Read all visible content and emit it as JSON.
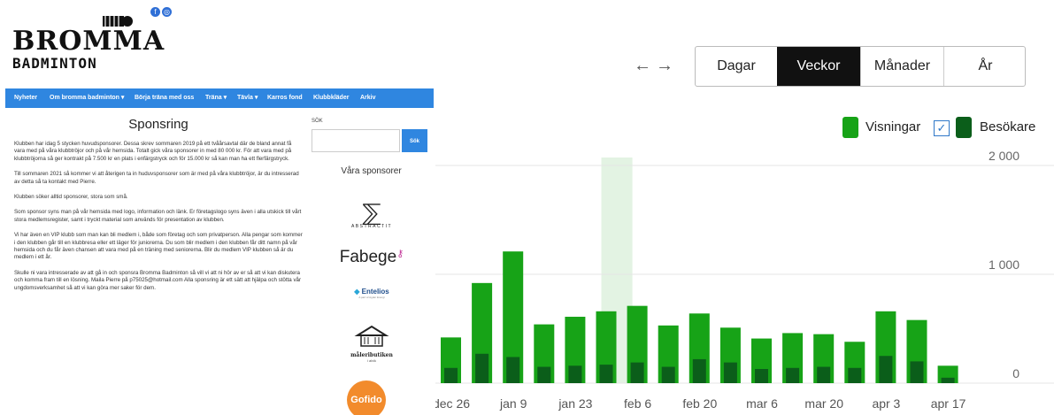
{
  "site": {
    "logo_line1": "BROMMA",
    "logo_line2": "BADMINTON",
    "nav": [
      "Nyheter",
      "Om bromma badminton ▾",
      "Börja träna med oss",
      "Träna ▾",
      "Tävla ▾",
      "Karros fond",
      "Klubbkläder",
      "Arkiv"
    ],
    "title": "Sponsring",
    "paragraphs": [
      "Klubben har idag 5 stycken huvudsponsorer. Dessa skrev sommaren 2019 på ett tvåårsavtal där de bland annat få vara med på våra klubbtröjor och på vår hemsida. Totalt gick våra sponsorer in med 80 000 kr. För att vara med på klubbtröjorna så ger kontrakt på 7.500 kr en plats i enfärgstryck och för 15.000 kr så kan man ha ett flerfärgstryck.",
      "Till sommaren 2021 så kommer vi att återigen ta in huduvsponsorer som är med på våra klubbtröjor, är du intresserad av detta så ta kontakt med Pierre.",
      "Klubben söker alltid sponsorer, stora som små.",
      "Som sponsor syns man på vår hemsida med logo, information och länk. Er företagslogo syns även i alla utskick till vårt stora medlemsregister, samt i tryckt material som används för presentation av klubben.",
      "Vi har även en VIP klubb som man kan bli medlem i, både som företag och som privatperson. Alla pengar som kommer i den klubben går till en klubbresa eller ett läger för juniorerna. Du som blir medlem i den klubben får ditt namn på vår hemsida och du får även chansen att vara med på en träning med seniorerna. Blir du medlem VIP klubben så är du medlem i ett år.",
      "Skulle ni vara intresserade av att gå in och sponsra Bromma Badminton så vill vi att ni hör av er så att vi kan diskutera och komma fram till en lösning. Maila Pierre på p75025@hotmail.com Alla sponsring är ett sätt att hjälpa och stötta vår ungdomsverksamhet så att vi kan göra mer saker för dem."
    ],
    "search_label": "SÖK",
    "search_placeholder": "",
    "search_button": "Sök",
    "sponsors_title": "Våra sponsorer",
    "sponsors": {
      "abstractit": "ABSTRACTIT",
      "fabege": "Fabege",
      "entelios": "Entelios",
      "entelios_sub": "A part of Agder Energi",
      "maleributiken": "måleributiken",
      "maleributiken_sub": "i alvik",
      "gofido": "Gofido"
    }
  },
  "stats": {
    "nav_prev": "←",
    "nav_next": "→",
    "tabs": [
      {
        "label": "Dagar",
        "active": false
      },
      {
        "label": "Veckor",
        "active": true
      },
      {
        "label": "Månader",
        "active": false
      },
      {
        "label": "År",
        "active": false
      }
    ],
    "legend_views": "Visningar",
    "legend_visitors": "Besökare",
    "colors": {
      "views": "#17a317",
      "visitors": "#0b5e1a",
      "highlight": "#e3f3e3",
      "active_tab": "#111111"
    }
  },
  "chart_data": {
    "type": "bar",
    "x_tick_labels": [
      "dec 26",
      "jan 9",
      "jan 23",
      "feb 6",
      "feb 20",
      "mar 6",
      "mar 20",
      "apr 3",
      "apr 17"
    ],
    "y_ticks": [
      "2 000",
      "1 000",
      "0"
    ],
    "ylim": [
      0,
      2000
    ],
    "highlight_week_index": 5,
    "series": [
      {
        "name": "Visningar",
        "values": [
          420,
          920,
          1210,
          540,
          610,
          660,
          710,
          530,
          640,
          510,
          410,
          460,
          450,
          380,
          660,
          580,
          160
        ]
      },
      {
        "name": "Besökare",
        "values": [
          140,
          270,
          240,
          150,
          160,
          170,
          190,
          150,
          220,
          190,
          130,
          140,
          150,
          140,
          250,
          200,
          50
        ]
      }
    ]
  }
}
